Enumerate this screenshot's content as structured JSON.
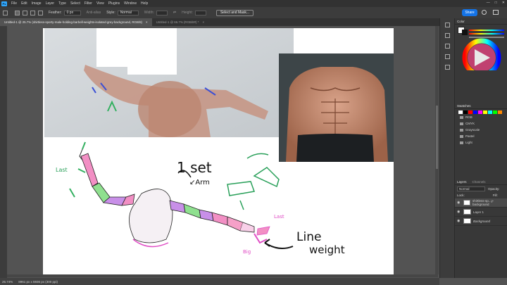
{
  "menu": {
    "logo": "Ps",
    "items": [
      "File",
      "Edit",
      "Image",
      "Layer",
      "Type",
      "Select",
      "Filter",
      "View",
      "Plugins",
      "Window",
      "Help"
    ],
    "window_controls": [
      "—",
      "□",
      "✕"
    ]
  },
  "options": {
    "feather_label": "Feather:",
    "feather_value": "0 px",
    "antialias_label": "Anti-alias",
    "style_label": "Style:",
    "style_value": "Normal",
    "width_label": "Width:",
    "height_label": "Height:",
    "select_mask_label": "Select and Mask...",
    "share_label": "Share"
  },
  "tabs": [
    {
      "label": "Untitled-1 @ 25.7% (shirtless-sporty-male-holding-barbell-weights-isolated-grey-background, RGB/8)",
      "close": "×",
      "active": true
    },
    {
      "label": "Untitled-1 @ 66.7% (RGB/8#) *",
      "close": "×",
      "active": false
    }
  ],
  "status": {
    "zoom": "25.74%",
    "doc_size": "8961 px x 5936 px (300 ppi)"
  },
  "canvas_text": {
    "set": "1 set",
    "arm": "↙Arm",
    "last1": "Last",
    "last2": "Last",
    "line": "Line",
    "weight": "weight",
    "big": "Big"
  },
  "panel": {
    "color_title": "Color",
    "swatches_title": "Swatches",
    "swatch_colors": [
      "#ffffff",
      "#000000",
      "#ff0000",
      "#0000ff",
      "#ff00ff",
      "#ffff00",
      "#00ffff",
      "#00ff00",
      "#ff8800"
    ],
    "folders": [
      "RGB",
      "CMYK",
      "Grayscale",
      "Pastel",
      "Light"
    ],
    "layers_title": "Layers",
    "channels_title": "Channels",
    "kind_label": "Normal",
    "opacity_label": "Opacity:",
    "lock_label": "Lock:",
    "fill_label": "Fill:",
    "layers": [
      {
        "name": "shirtless-sp...y-background",
        "selected": true
      },
      {
        "name": "Layer 1",
        "selected": false
      },
      {
        "name": "Background",
        "selected": false
      }
    ]
  }
}
